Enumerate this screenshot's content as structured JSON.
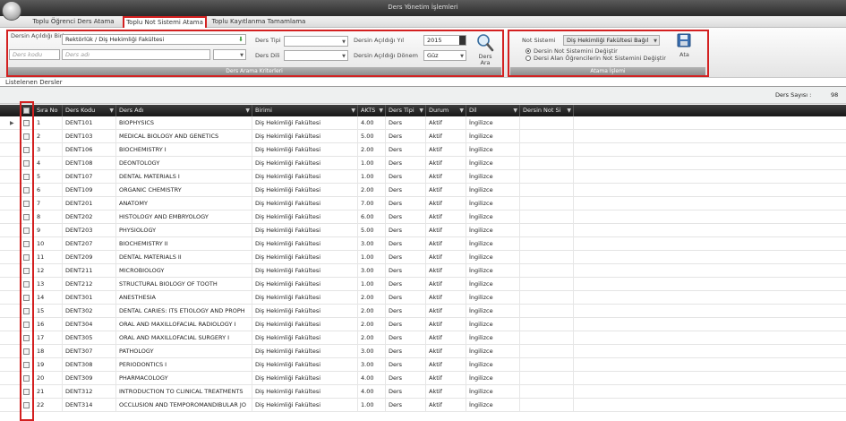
{
  "window": {
    "title": "Ders Yönetim İşlemleri"
  },
  "tabs": [
    {
      "label": "Toplu Öğrenci Ders Atama"
    },
    {
      "label": "Toplu Not Sistemi Atama"
    },
    {
      "label": "Toplu Kayıtlanma Tamamlama"
    }
  ],
  "search": {
    "birim_label": "Dersin Açıldığı Birim",
    "birim_value": "Rektörlük / Diş Hekimliği Fakültesi",
    "ders_kodu_placeholder": "Ders kodu",
    "ders_adi_placeholder": "Ders adı",
    "ders_tipi_label": "Ders Tipi",
    "ders_dili_label": "Ders Dili",
    "yil_label": "Dersin Açıldığı Yıl",
    "yil_value": "2015",
    "donem_label": "Dersin Açıldığı Dönem",
    "donem_value": "Güz",
    "search_button_label": "Ders Ara",
    "group_title": "Ders Arama Kriterleri"
  },
  "assign": {
    "not_sistemi_label": "Not Sistemi",
    "not_sistemi_value": "Diş Hekimliği Fakültesi Bağıl",
    "radio1_label": "Dersin Not Sistemini Değiştir",
    "radio2_label": "Dersi Alan Öğrencilerin Not Sistemini Değiştir",
    "ata_label": "Ata",
    "group_title": "Atama İşlemi"
  },
  "list": {
    "title": "Listelenen Dersler",
    "count_label": "Ders Sayısı :",
    "count_value": "98"
  },
  "columns": [
    "Sıra No",
    "Ders Kodu",
    "Ders Adı",
    "Birimi",
    "AKTS",
    "Ders Tipi",
    "Durum",
    "Dil",
    "Dersin Not Si"
  ],
  "rows": [
    [
      "1",
      "DENT101",
      "BIOPHYSICS",
      "Diş Hekimliği Fakültesi",
      "4.00",
      "Ders",
      "Aktif",
      "İngilizce",
      ""
    ],
    [
      "2",
      "DENT103",
      "MEDICAL BIOLOGY AND GENETICS",
      "Diş Hekimliği Fakültesi",
      "5.00",
      "Ders",
      "Aktif",
      "İngilizce",
      ""
    ],
    [
      "3",
      "DENT106",
      "BIOCHEMISTRY I",
      "Diş Hekimliği Fakültesi",
      "2.00",
      "Ders",
      "Aktif",
      "İngilizce",
      ""
    ],
    [
      "4",
      "DENT108",
      "DEONTOLOGY",
      "Diş Hekimliği Fakültesi",
      "1.00",
      "Ders",
      "Aktif",
      "İngilizce",
      ""
    ],
    [
      "5",
      "DENT107",
      "DENTAL MATERIALS I",
      "Diş Hekimliği Fakültesi",
      "1.00",
      "Ders",
      "Aktif",
      "İngilizce",
      ""
    ],
    [
      "6",
      "DENT109",
      "ORGANIC CHEMISTRY",
      "Diş Hekimliği Fakültesi",
      "2.00",
      "Ders",
      "Aktif",
      "İngilizce",
      ""
    ],
    [
      "7",
      "DENT201",
      "ANATOMY",
      "Diş Hekimliği Fakültesi",
      "7.00",
      "Ders",
      "Aktif",
      "İngilizce",
      ""
    ],
    [
      "8",
      "DENT202",
      "HISTOLOGY AND EMBRYOLOGY",
      "Diş Hekimliği Fakültesi",
      "6.00",
      "Ders",
      "Aktif",
      "İngilizce",
      ""
    ],
    [
      "9",
      "DENT203",
      "PHYSIOLOGY",
      "Diş Hekimliği Fakültesi",
      "5.00",
      "Ders",
      "Aktif",
      "İngilizce",
      ""
    ],
    [
      "10",
      "DENT207",
      "BIOCHEMISTRY II",
      "Diş Hekimliği Fakültesi",
      "3.00",
      "Ders",
      "Aktif",
      "İngilizce",
      ""
    ],
    [
      "11",
      "DENT209",
      "DENTAL MATERIALS II",
      "Diş Hekimliği Fakültesi",
      "1.00",
      "Ders",
      "Aktif",
      "İngilizce",
      ""
    ],
    [
      "12",
      "DENT211",
      "MICROBIOLOGY",
      "Diş Hekimliği Fakültesi",
      "3.00",
      "Ders",
      "Aktif",
      "İngilizce",
      ""
    ],
    [
      "13",
      "DENT212",
      "STRUCTURAL BIOLOGY OF TOOTH",
      "Diş Hekimliği Fakültesi",
      "1.00",
      "Ders",
      "Aktif",
      "İngilizce",
      ""
    ],
    [
      "14",
      "DENT301",
      "ANESTHESIA",
      "Diş Hekimliği Fakültesi",
      "2.00",
      "Ders",
      "Aktif",
      "İngilizce",
      ""
    ],
    [
      "15",
      "DENT302",
      "DENTAL CARIES: ITS ETIOLOGY AND PROPH",
      "Diş Hekimliği Fakültesi",
      "2.00",
      "Ders",
      "Aktif",
      "İngilizce",
      ""
    ],
    [
      "16",
      "DENT304",
      "ORAL AND MAXILLOFACIAL RADIOLOGY I",
      "Diş Hekimliği Fakültesi",
      "2.00",
      "Ders",
      "Aktif",
      "İngilizce",
      ""
    ],
    [
      "17",
      "DENT305",
      "ORAL AND MAXILLOFACIAL SURGERY I",
      "Diş Hekimliği Fakültesi",
      "2.00",
      "Ders",
      "Aktif",
      "İngilizce",
      ""
    ],
    [
      "18",
      "DENT307",
      "PATHOLOGY",
      "Diş Hekimliği Fakültesi",
      "3.00",
      "Ders",
      "Aktif",
      "İngilizce",
      ""
    ],
    [
      "19",
      "DENT308",
      "PERIODONTICS I",
      "Diş Hekimliği Fakültesi",
      "3.00",
      "Ders",
      "Aktif",
      "İngilizce",
      ""
    ],
    [
      "20",
      "DENT309",
      "PHARMACOLOGY",
      "Diş Hekimliği Fakültesi",
      "4.00",
      "Ders",
      "Aktif",
      "İngilizce",
      ""
    ],
    [
      "21",
      "DENT312",
      "INTRODUCTION TO CLINICAL TREATMENTS",
      "Diş Hekimliği Fakültesi",
      "4.00",
      "Ders",
      "Aktif",
      "İngilizce",
      ""
    ],
    [
      "22",
      "DENT314",
      "OCCLUSION AND TEMPOROMANDIBULAR JO",
      "Diş Hekimliği Fakültesi",
      "1.00",
      "Ders",
      "Aktif",
      "İngilizce",
      ""
    ]
  ],
  "colors": {
    "highlight": "#d32020",
    "header_bg": "#1f1f1f"
  }
}
